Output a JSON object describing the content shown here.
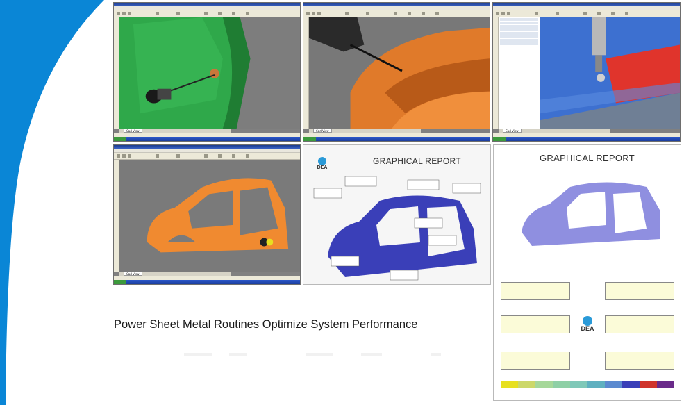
{
  "caption": "Power Sheet Metal Routines Optimize System Performance",
  "report_left": {
    "title": "GRAPHICAL REPORT",
    "logo_text": "DEA"
  },
  "report_right": {
    "title": "GRAPHICAL REPORT",
    "logo_text": "DEA"
  },
  "cad_tab_label": "Cad View",
  "colors": {
    "swoosh": "#0a86d6",
    "door_green": "#2fa84a",
    "fender_orange": "#e07a2a",
    "panel_blue": "#3d70d0",
    "panel_red": "#e0342c",
    "body_orange": "#f08a30",
    "report_blue": "#3a3fb8",
    "report_lavender": "#8f8fe0"
  }
}
